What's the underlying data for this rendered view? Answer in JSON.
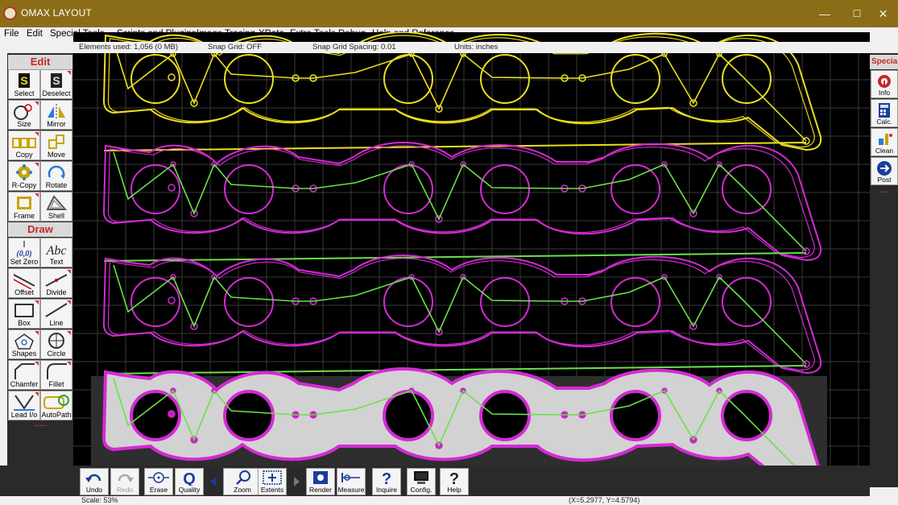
{
  "window": {
    "title": "OMAX LAYOUT",
    "minimize": "—",
    "maximize": "☐",
    "close": "✕"
  },
  "menu": [
    "File",
    "Edit",
    "Special Tools",
    "Scripts and Plugins",
    "Image Tracing",
    "XData",
    "Extra Tools",
    "Debug",
    "Help and Reference"
  ],
  "status_top": {
    "elements": "Elements used: 1,056 (0 MB)",
    "snap_grid": "Snap Grid: OFF",
    "snap_spacing": "Snap Grid Spacing: 0.01",
    "units": "Units: inches"
  },
  "left_toolbar": {
    "edit_header": "Edit",
    "draw_header": "Draw",
    "dashes": "-----",
    "edit_tools": [
      {
        "label": "Select",
        "icon": "select-icon"
      },
      {
        "label": "Deselect",
        "icon": "deselect-icon"
      },
      {
        "label": "Size",
        "icon": "size-icon"
      },
      {
        "label": "Mirror",
        "icon": "mirror-icon"
      },
      {
        "label": "Copy",
        "icon": "copy-icon"
      },
      {
        "label": "Move",
        "icon": "move-icon"
      },
      {
        "label": "R-Copy",
        "icon": "rotate-copy-icon"
      },
      {
        "label": "Rotate",
        "icon": "rotate-icon"
      },
      {
        "label": "Frame",
        "icon": "frame-icon"
      },
      {
        "label": "Shell",
        "icon": "shell-icon"
      }
    ],
    "draw_tools": [
      {
        "label": "Set Zero",
        "icon": "set-zero-icon"
      },
      {
        "label": "Text",
        "icon": "text-icon"
      },
      {
        "label": "Offset",
        "icon": "offset-icon"
      },
      {
        "label": "Divide",
        "icon": "divide-icon"
      },
      {
        "label": "Box",
        "icon": "box-icon"
      },
      {
        "label": "Line",
        "icon": "line-icon"
      },
      {
        "label": "Shapes",
        "icon": "shapes-icon"
      },
      {
        "label": "Circle",
        "icon": "circle-icon"
      },
      {
        "label": "Chamfer",
        "icon": "chamfer-icon"
      },
      {
        "label": "Fillet",
        "icon": "fillet-icon"
      },
      {
        "label": "Lead I/o",
        "icon": "lead-io-icon"
      },
      {
        "label": "AutoPath",
        "icon": "autopath-icon"
      }
    ],
    "set_zero_glyph": "(0,0)",
    "text_glyph": "Abc"
  },
  "right_toolbar": {
    "header": "Specia",
    "dashes": "---",
    "tools": [
      {
        "label": "Info",
        "icon": "info-icon"
      },
      {
        "label": "Calc.",
        "icon": "calculator-icon"
      },
      {
        "label": "Clean",
        "icon": "clean-icon"
      },
      {
        "label": "Post",
        "icon": "post-icon"
      }
    ]
  },
  "bottom_toolbar": {
    "tools": [
      {
        "label": "Undo",
        "icon": "undo-icon",
        "enabled": true
      },
      {
        "label": "Redo",
        "icon": "redo-icon",
        "enabled": false
      },
      {
        "label": "Erase",
        "icon": "erase-icon",
        "enabled": true
      },
      {
        "label": "Quality",
        "icon": "quality-icon",
        "enabled": true
      },
      {
        "label": "Zoom",
        "icon": "zoom-icon",
        "enabled": true
      },
      {
        "label": "Extents",
        "icon": "extents-icon",
        "enabled": true
      },
      {
        "label": "Render",
        "icon": "render-icon",
        "enabled": true
      },
      {
        "label": "Measure",
        "icon": "measure-icon",
        "enabled": true
      },
      {
        "label": "Inquire",
        "icon": "inquire-icon",
        "enabled": true
      },
      {
        "label": "Config.",
        "icon": "config-icon",
        "enabled": true
      },
      {
        "label": "Help",
        "icon": "help-icon",
        "enabled": true
      }
    ]
  },
  "status_bottom": {
    "scale": "Scale: 53%",
    "coords": "(X=5.2977, Y=4.5794)"
  },
  "colors": {
    "titlebar": "#8b6d18",
    "canvas": "#000000",
    "part_yellow": "#ecdf1e",
    "part_magenta": "#d42ad4",
    "toolpath_green": "#6be04a",
    "grid": "#3a3a3a",
    "accent_red": "#c62828"
  }
}
